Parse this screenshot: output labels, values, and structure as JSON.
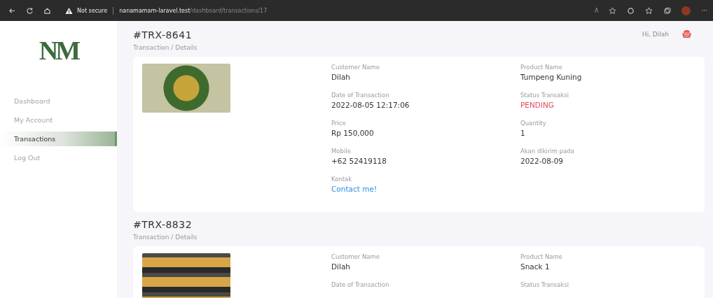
{
  "browser": {
    "security_label": "Not secure",
    "url_host": "nanamamam-laravel.test",
    "url_path": "/dashboard/transactions/17",
    "read_aloud": "A",
    "more": "···"
  },
  "sidebar": {
    "logo": "NM",
    "items": [
      {
        "label": "Dashboard",
        "selected": false
      },
      {
        "label": "My Account",
        "selected": false
      },
      {
        "label": "Transactions",
        "selected": true
      },
      {
        "label": "Log Out",
        "selected": false
      }
    ]
  },
  "header": {
    "greeting": "Hi, Dilah"
  },
  "transactions": [
    {
      "id": "#TRX-8641",
      "breadcrumb": "Transaction / Details",
      "fields": [
        {
          "label": "Customer Name",
          "value": "Dilah",
          "kind": "text"
        },
        {
          "label": "Product Name",
          "value": "Tumpeng Kuning",
          "kind": "text"
        },
        {
          "label": "Date of Transaction",
          "value": "2022-08-05 12:17:06",
          "kind": "text"
        },
        {
          "label": "Status Transaksi",
          "value": "PENDING",
          "kind": "status"
        },
        {
          "label": "Price",
          "value": "Rp 150,000",
          "kind": "text"
        },
        {
          "label": "Quantity",
          "value": "1",
          "kind": "text"
        },
        {
          "label": "Mobile",
          "value": "+62 52419118",
          "kind": "text"
        },
        {
          "label": "Akan dikirim pada",
          "value": "2022-08-09",
          "kind": "text"
        },
        {
          "label": "Kontak",
          "value": "Contact me!",
          "kind": "link"
        }
      ]
    },
    {
      "id": "#TRX-8832",
      "breadcrumb": "Transaction / Details",
      "fields": [
        {
          "label": "Customer Name",
          "value": "Dilah",
          "kind": "text"
        },
        {
          "label": "Product Name",
          "value": "Snack 1",
          "kind": "text"
        },
        {
          "label": "Date of Transaction"
        },
        {
          "label": "Status Transaksi"
        }
      ]
    }
  ]
}
